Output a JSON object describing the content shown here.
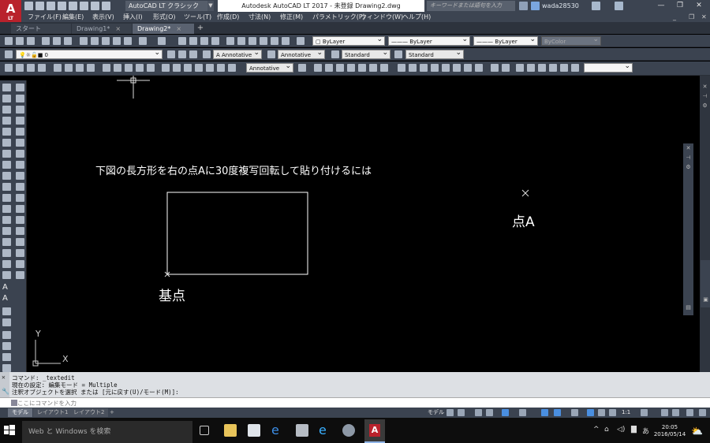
{
  "app": {
    "logo": "A",
    "logo_sub": "LT"
  },
  "titlebar": {
    "workspace": "AutoCAD LT クラシック",
    "title": "Autodesk AutoCAD LT 2017 - 未登録    Drawing2.dwg",
    "search_placeholder": "キーワードまたは語句を入力",
    "user": "wada28530"
  },
  "menu": [
    "ファイル(F)",
    "編集(E)",
    "表示(V)",
    "挿入(I)",
    "形式(O)",
    "ツール(T)",
    "作成(D)",
    "寸法(N)",
    "修正(M)",
    "パラメトリック(P)",
    "ウィンドウ(W)",
    "ヘルプ(H)"
  ],
  "tabs": [
    {
      "label": "スタート"
    },
    {
      "label": "Drawing1*"
    },
    {
      "label": "Drawing2*"
    }
  ],
  "properties": {
    "color": "ByLayer",
    "linetype": "ByLayer",
    "lineweight": "ByLayer",
    "plotstyle": "ByColor"
  },
  "layers": {
    "current": "0"
  },
  "styles": {
    "text_style": "Annotative",
    "dim_style": "Annotative",
    "table_style": "Standard",
    "mleader_style": "Standard",
    "multileader": "Annotative"
  },
  "drawing": {
    "instruction": "下図の長方形を右の点Aに30度複写回転して貼り付けるには",
    "point_a_label": "点A",
    "base_label": "基点",
    "axis_y": "Y",
    "axis_x": "X"
  },
  "command": {
    "lines": [
      "コマンド: _textedit",
      "現在の設定: 編集モード = Multiple",
      "注釈オブジェクトを選択 または [元に戻す(U)/モード(M)]:"
    ],
    "placeholder": "ここにコマンドを入力"
  },
  "layout_tabs": [
    "モデル",
    "レイアウト1",
    "レイアウト2"
  ],
  "status": {
    "model": "モデル",
    "scale": "1:1"
  },
  "taskbar": {
    "search": "Web と Windows を検索",
    "time": "20:05",
    "date": "2016/05/14",
    "ime": "あ"
  },
  "colors": {
    "accent": "#b9222c",
    "canvas": "#000000",
    "ribbon": "#3b4350"
  }
}
